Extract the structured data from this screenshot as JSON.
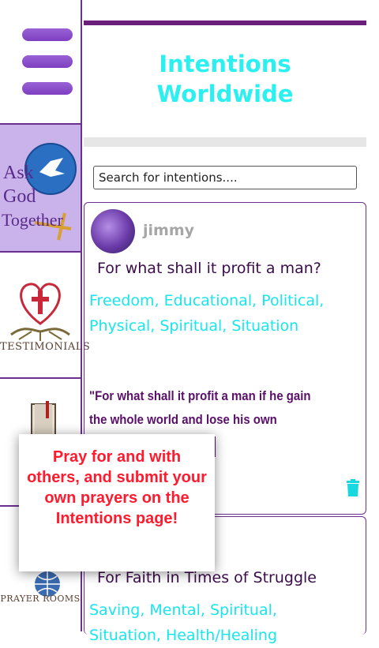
{
  "sidebar": {
    "ask": {
      "line1": "Ask",
      "line2": "God",
      "line3": "Together"
    },
    "testimonials_label": "TESTIMONIALS",
    "prayer_rooms_label": "PRAYER ROOMS"
  },
  "header": {
    "title_line1": "Intentions",
    "title_line2": "Worldwide"
  },
  "search": {
    "placeholder": "Search for intentions...."
  },
  "posts": [
    {
      "user": "jimmy",
      "title": "For what shall it profit a man?",
      "tags": "Freedom, Educational, Political, Physical, Spiritual, Situation",
      "quote": "\"For what shall it profit a man if he gain the whole world and lose his own"
    },
    {
      "title": "For Faith in Times of Struggle",
      "tags": "Saving, Mental, Spiritual, Situation, Health/Healing"
    }
  ],
  "tooltip": {
    "text": "Pray for and with others, and submit your own prayers on the Intentions page!"
  },
  "colors": {
    "accent_purple": "#6b2f8f",
    "title_cyan": "#2cf0f0",
    "tag_cyan": "#18e6ee",
    "tooltip_red": "#ff1a2e"
  }
}
